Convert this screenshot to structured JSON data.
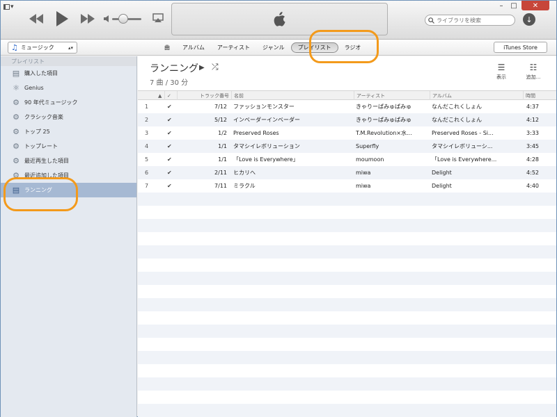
{
  "topbar": {
    "search_placeholder": "ライブラリを検索",
    "download_glyph": "↓",
    "window_min": "–",
    "window_max": "□",
    "window_close": "✕"
  },
  "nav": {
    "library_select": "ミュージック",
    "tabs": [
      {
        "label": "曲",
        "active": false
      },
      {
        "label": "アルバム",
        "active": false
      },
      {
        "label": "アーティスト",
        "active": false
      },
      {
        "label": "ジャンル",
        "active": false
      },
      {
        "label": "プレイリスト",
        "active": true
      },
      {
        "label": "ラジオ",
        "active": false
      }
    ],
    "store_label": "iTunes Store"
  },
  "sidebar": {
    "header": "プレイリスト",
    "items": [
      {
        "label": "購入した項目",
        "icon": "playlist-icon",
        "selected": false
      },
      {
        "label": "Genius",
        "icon": "genius-icon",
        "selected": false
      },
      {
        "label": "90 年代ミュージック",
        "icon": "smart-playlist-icon",
        "selected": false
      },
      {
        "label": "クラシック音楽",
        "icon": "smart-playlist-icon",
        "selected": false
      },
      {
        "label": "トップ 25",
        "icon": "smart-playlist-icon",
        "selected": false
      },
      {
        "label": "トップレート",
        "icon": "smart-playlist-icon",
        "selected": false
      },
      {
        "label": "最近再生した項目",
        "icon": "smart-playlist-icon",
        "selected": false
      },
      {
        "label": "最近追加した項目",
        "icon": "smart-playlist-icon",
        "selected": false
      },
      {
        "label": "ランニング",
        "icon": "playlist-icon",
        "selected": true
      }
    ]
  },
  "playlist": {
    "title": "ランニング",
    "summary": "7 曲 / 30 分",
    "view_label": "表示",
    "add_label": "追加..."
  },
  "table": {
    "headers": {
      "sort": "▲",
      "check": "✓",
      "track": "トラック番号",
      "name": "名前",
      "artist": "アーティスト",
      "album": "アルバム",
      "time": "時間"
    },
    "rows": [
      {
        "num": "1",
        "check": "✔",
        "track": "7/12",
        "name": "ファッションモンスター",
        "artist": "きゃりーぱみゅぱみゅ",
        "album": "なんだこれくしょん",
        "time": "4:37"
      },
      {
        "num": "2",
        "check": "✔",
        "track": "5/12",
        "name": "インベーダーインベーダー",
        "artist": "きゃりーぱみゅぱみゅ",
        "album": "なんだこれくしょん",
        "time": "4:12"
      },
      {
        "num": "3",
        "check": "✔",
        "track": "1/2",
        "name": "Preserved Roses",
        "artist": "T.M.Revolution×水...",
        "album": "Preserved Roses - Si...",
        "time": "3:33"
      },
      {
        "num": "4",
        "check": "✔",
        "track": "1/1",
        "name": "タマシイレボリューション",
        "artist": "Superfly",
        "album": "タマシイレボリューシ...",
        "time": "3:45"
      },
      {
        "num": "5",
        "check": "✔",
        "track": "1/1",
        "name": "「Love is Everywhere」",
        "artist": "moumoon",
        "album": "「Love is Everywhere...",
        "time": "4:28"
      },
      {
        "num": "6",
        "check": "✔",
        "track": "2/11",
        "name": "ヒカリへ",
        "artist": "miwa",
        "album": "Delight",
        "time": "4:52"
      },
      {
        "num": "7",
        "check": "✔",
        "track": "7/11",
        "name": "ミラクル",
        "artist": "miwa",
        "album": "Delight",
        "time": "4:40"
      }
    ]
  },
  "colors": {
    "highlight_ring": "#f39a1b",
    "sidebar_selected": "#a6b9d3",
    "row_stripe": "#f0f3f8"
  }
}
